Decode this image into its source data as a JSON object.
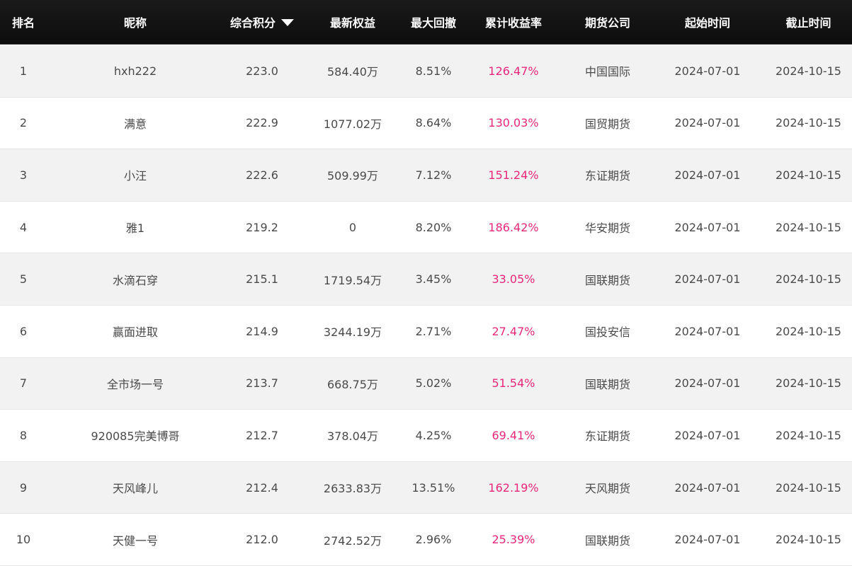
{
  "header": {
    "rank": "排名",
    "nickname": "昵称",
    "score": "综合积分",
    "equity": "最新权益",
    "max_drawdown": "最大回撤",
    "cum_return": "累计收益率",
    "company": "期货公司",
    "start_time": "起始时间",
    "end_time": "截止时间",
    "sort_icon": "caret-down-icon"
  },
  "colors": {
    "header_bg": "#111111",
    "header_text": "#ffffff",
    "return_text": "#e8287a",
    "row_alt_bg": "#f2f2f2"
  },
  "rows": [
    {
      "rank": "1",
      "nickname": "hxh222",
      "score": "223.0",
      "equity": "584.40万",
      "max_drawdown": "8.51%",
      "cum_return": "126.47%",
      "company": "中国国际",
      "start": "2024-07-01",
      "end": "2024-10-15"
    },
    {
      "rank": "2",
      "nickname": "满意",
      "score": "222.9",
      "equity": "1077.02万",
      "max_drawdown": "8.64%",
      "cum_return": "130.03%",
      "company": "国贸期货",
      "start": "2024-07-01",
      "end": "2024-10-15"
    },
    {
      "rank": "3",
      "nickname": "小汪",
      "score": "222.6",
      "equity": "509.99万",
      "max_drawdown": "7.12%",
      "cum_return": "151.24%",
      "company": "东证期货",
      "start": "2024-07-01",
      "end": "2024-10-15"
    },
    {
      "rank": "4",
      "nickname": "雅1",
      "score": "219.2",
      "equity": "0",
      "max_drawdown": "8.20%",
      "cum_return": "186.42%",
      "company": "华安期货",
      "start": "2024-07-01",
      "end": "2024-10-15"
    },
    {
      "rank": "5",
      "nickname": "水滴石穿",
      "score": "215.1",
      "equity": "1719.54万",
      "max_drawdown": "3.45%",
      "cum_return": "33.05%",
      "company": "国联期货",
      "start": "2024-07-01",
      "end": "2024-10-15"
    },
    {
      "rank": "6",
      "nickname": "赢面进取",
      "score": "214.9",
      "equity": "3244.19万",
      "max_drawdown": "2.71%",
      "cum_return": "27.47%",
      "company": "国投安信",
      "start": "2024-07-01",
      "end": "2024-10-15"
    },
    {
      "rank": "7",
      "nickname": "全市场一号",
      "score": "213.7",
      "equity": "668.75万",
      "max_drawdown": "5.02%",
      "cum_return": "51.54%",
      "company": "国联期货",
      "start": "2024-07-01",
      "end": "2024-10-15"
    },
    {
      "rank": "8",
      "nickname": "920085完美博哥",
      "score": "212.7",
      "equity": "378.04万",
      "max_drawdown": "4.25%",
      "cum_return": "69.41%",
      "company": "东证期货",
      "start": "2024-07-01",
      "end": "2024-10-15"
    },
    {
      "rank": "9",
      "nickname": "天风峰儿",
      "score": "212.4",
      "equity": "2633.83万",
      "max_drawdown": "13.51%",
      "cum_return": "162.19%",
      "company": "天风期货",
      "start": "2024-07-01",
      "end": "2024-10-15"
    },
    {
      "rank": "10",
      "nickname": "天健一号",
      "score": "212.0",
      "equity": "2742.52万",
      "max_drawdown": "2.96%",
      "cum_return": "25.39%",
      "company": "国联期货",
      "start": "2024-07-01",
      "end": "2024-10-15"
    }
  ]
}
